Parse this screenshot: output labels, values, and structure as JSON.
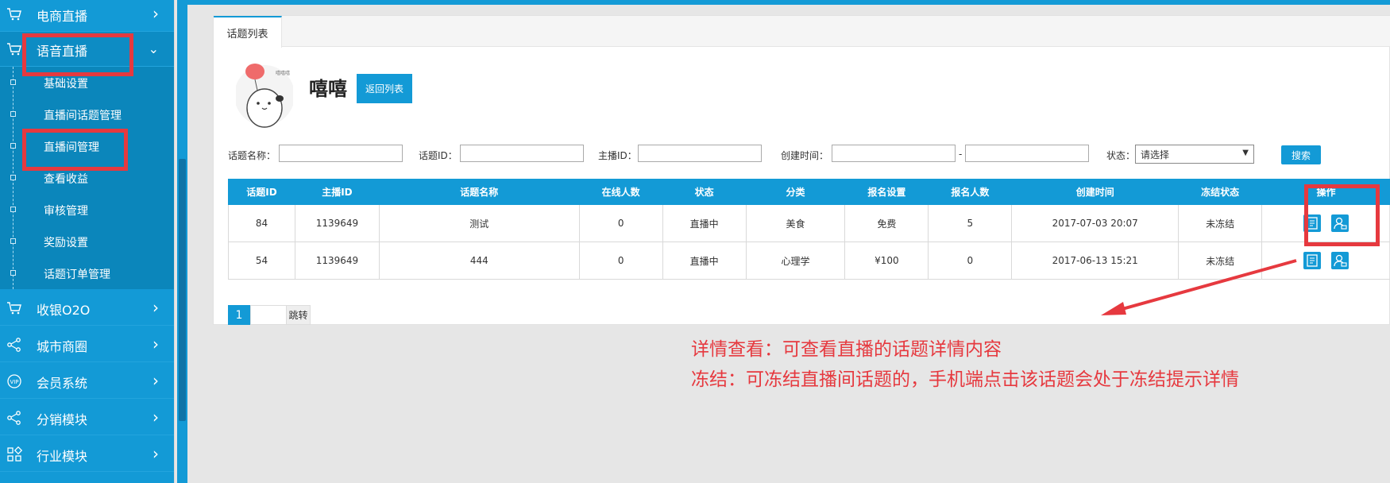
{
  "sidebar": {
    "items": [
      {
        "label": "电商直播",
        "icon": "cart-icon"
      },
      {
        "label": "语音直播",
        "icon": "cart-icon"
      },
      {
        "label": "收银O2O",
        "icon": "cart-icon"
      },
      {
        "label": "城市商圈",
        "icon": "share-icon"
      },
      {
        "label": "会员系统",
        "icon": "vip-icon"
      },
      {
        "label": "分销模块",
        "icon": "share-icon"
      },
      {
        "label": "行业模块",
        "icon": "grid-icon"
      }
    ],
    "submenu": [
      "基础设置",
      "直播间话题管理",
      "直播间管理",
      "查看收益",
      "审核管理",
      "奖励设置",
      "话题订单管理"
    ]
  },
  "panel": {
    "tab_label": "话题列表",
    "host_name": "嘻嘻",
    "back_button": "返回列表",
    "avatar_caption": "嘻嘻嘻"
  },
  "filters": {
    "topic_name_label": "话题名称：",
    "topic_id_label": "话题ID：",
    "host_id_label": "主播ID：",
    "created_label": "创建时间：",
    "range_sep": "-",
    "status_label": "状态：",
    "status_value": "请选择",
    "search_button": "搜索"
  },
  "table": {
    "headers": [
      "话题ID",
      "主播ID",
      "话题名称",
      "在线人数",
      "状态",
      "分类",
      "报名设置",
      "报名人数",
      "创建时间",
      "冻结状态",
      "操作"
    ],
    "rows": [
      [
        "84",
        "1139649",
        "测试",
        "0",
        "直播中",
        "美食",
        "免费",
        "5",
        "2017-07-03 20:07",
        "未冻结"
      ],
      [
        "54",
        "1139649",
        "444",
        "0",
        "直播中",
        "心理学",
        "¥100",
        "0",
        "2017-06-13 15:21",
        "未冻结"
      ]
    ]
  },
  "pager": {
    "current": "1",
    "jump_label": "跳转"
  },
  "annotations": {
    "line1": "详情查看：可查看直播的话题详情内容",
    "line2": "冻结：可冻结直播间话题的，手机端点击该话题会处于冻结提示详情"
  },
  "colors": {
    "primary": "#139ad6",
    "highlight": "#e6393f"
  }
}
